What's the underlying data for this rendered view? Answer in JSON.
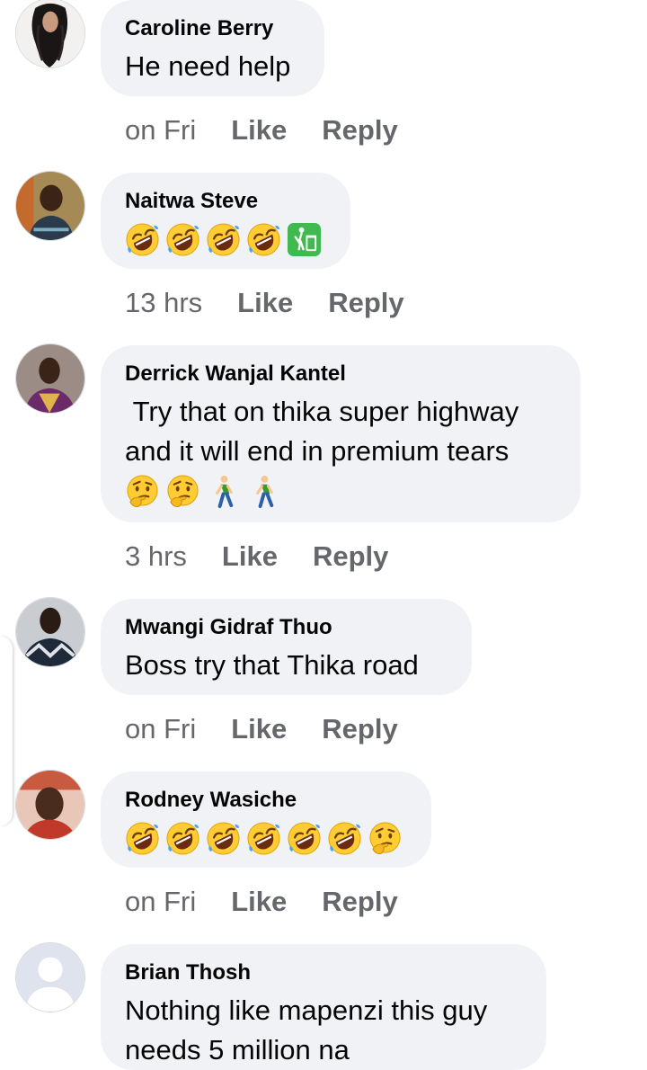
{
  "comments": [
    {
      "author": "Caroline Berry",
      "text": "He need help",
      "emojis": [],
      "time": "on Fri",
      "like_label": "Like",
      "reply_label": "Reply"
    },
    {
      "author": "Naitwa Steve",
      "text": "",
      "emojis": [
        "rofl-emoji",
        "rofl-emoji",
        "rofl-emoji",
        "rofl-emoji",
        "litter-bin-emoji"
      ],
      "time": "13 hrs",
      "like_label": "Like",
      "reply_label": "Reply"
    },
    {
      "author": "Derrick Wanjal Kantel",
      "text": " Try that on thika super highway\nand it will end in premium tears",
      "emojis": [
        "thinking-emoji",
        "thinking-emoji",
        "walking-person-emoji",
        "walking-person-emoji"
      ],
      "time": "3 hrs",
      "like_label": "Like",
      "reply_label": "Reply"
    },
    {
      "author": "Mwangi Gidraf Thuo",
      "text": "Boss try that Thika road",
      "emojis": [],
      "time": "on Fri",
      "like_label": "Like",
      "reply_label": "Reply"
    },
    {
      "author": "Rodney Wasiche",
      "text": "",
      "emojis": [
        "rofl-emoji",
        "rofl-emoji",
        "rofl-emoji",
        "rofl-emoji",
        "rofl-emoji",
        "rofl-emoji",
        "thinking-emoji"
      ],
      "time": "on Fri",
      "like_label": "Like",
      "reply_label": "Reply"
    },
    {
      "author": "Brian Thosh",
      "text": "Nothing like mapenzi this guy\nneeds 5 million na",
      "emojis": [],
      "time": "",
      "like_label": "",
      "reply_label": ""
    }
  ],
  "colors": {
    "bubble": "#f0f2f5",
    "meta_text": "#65676b",
    "body_text": "#050505"
  }
}
